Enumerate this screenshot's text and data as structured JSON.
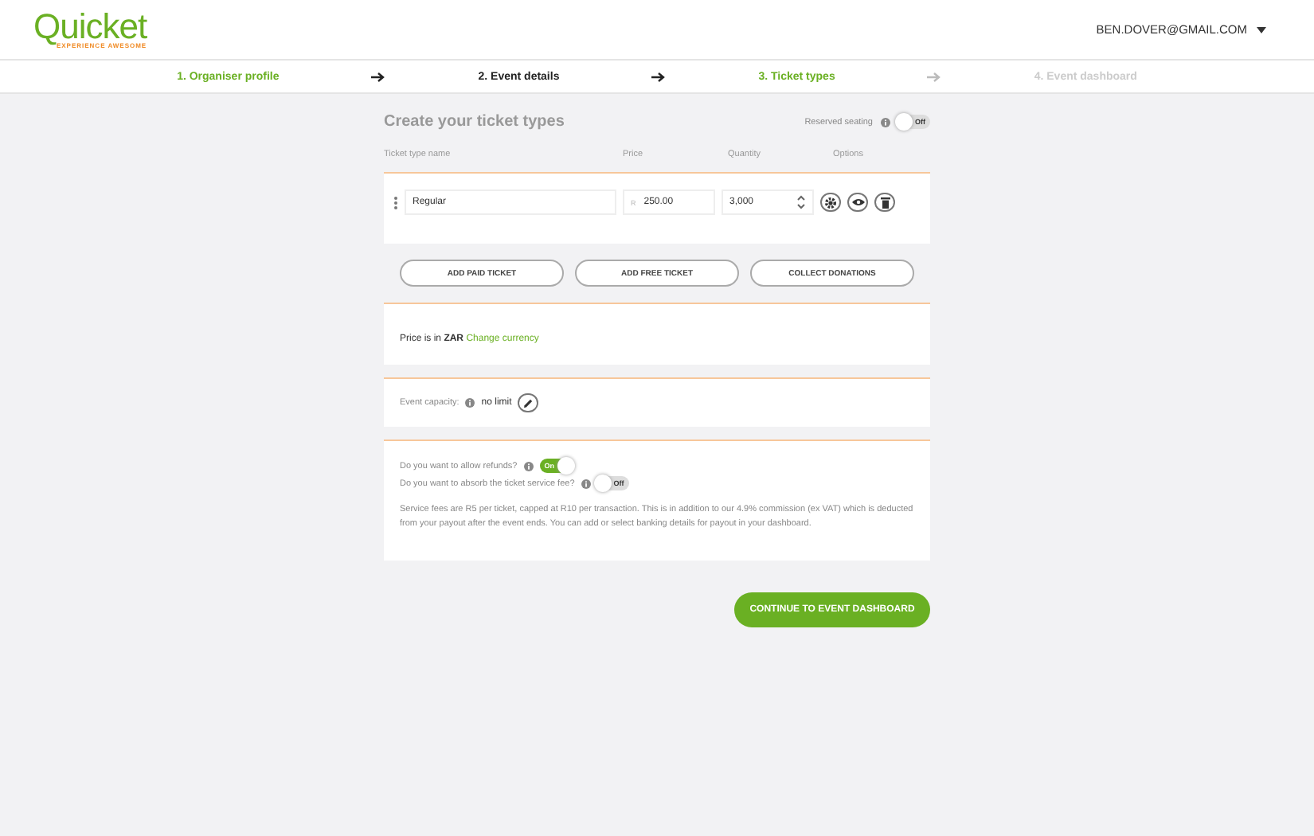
{
  "header": {
    "logo": "Quicket",
    "tagline": "EXPERIENCE AWESOME",
    "user": "BEN.DOVER@GMAIL.COM"
  },
  "steps": [
    {
      "label": "1. Organiser profile",
      "selected": false,
      "disabled": false
    },
    {
      "label": "2. Event details",
      "selected": true,
      "disabled": false
    },
    {
      "label": "3. Ticket types",
      "selected": false,
      "disabled": false
    },
    {
      "label": "4. Event dashboard",
      "selected": false,
      "disabled": true
    }
  ],
  "title": "Create your ticket types",
  "reserved_seating": {
    "label": "Reserved seating",
    "on": false,
    "toggle_text": "Off"
  },
  "columns": [
    "Ticket type name",
    "Price",
    "Quantity",
    "Options"
  ],
  "tickets": [
    {
      "name": "Regular",
      "currency": "R",
      "price": "250.00",
      "quantity": "3,000"
    }
  ],
  "actions": [
    "ADD PAID TICKET",
    "ADD FREE TICKET",
    "COLLECT DONATIONS"
  ],
  "currency": {
    "text": "Price is in **ZAR**",
    "link": "Change currency"
  },
  "capacity": {
    "label": "Event capacity:",
    "value": "no limit"
  },
  "settings": [
    {
      "label": "Do you want to allow refunds?",
      "on": true,
      "toggle_text": "On"
    },
    {
      "label": "Do you want to absorb the ticket service fee?",
      "on": false,
      "toggle_text": "Off"
    }
  ],
  "note": "Service fees are R5 per ticket, capped at R10 per transaction. This is in addition to our 4.9% commission (ex VAT) which is deducted from your payout after the event ends. You can add or select banking details for payout in your dashboard.",
  "continue_button": "CONTINUE TO EVENT DASHBOARD"
}
